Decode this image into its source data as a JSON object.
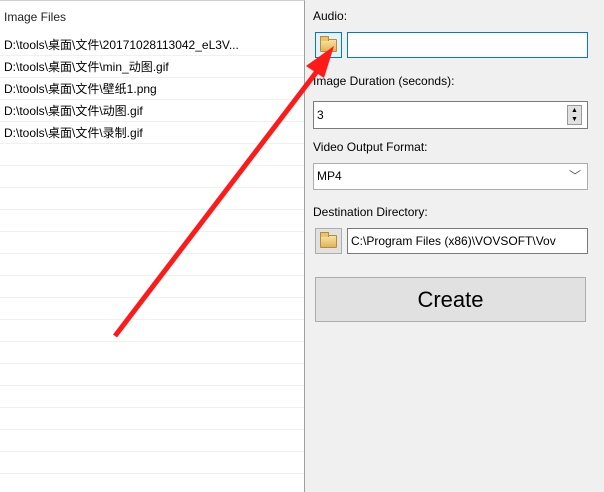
{
  "list": {
    "header": "Image Files",
    "items": [
      "D:\\tools\\桌面\\文件\\20171028113042_eL3V...",
      "D:\\tools\\桌面\\文件\\min_动图.gif",
      "D:\\tools\\桌面\\文件\\壁纸1.png",
      "D:\\tools\\桌面\\文件\\动图.gif",
      "D:\\tools\\桌面\\文件\\录制.gif"
    ]
  },
  "audio": {
    "label": "Audio:",
    "value": ""
  },
  "duration": {
    "label": "Image Duration (seconds):",
    "value": "3"
  },
  "format": {
    "label": "Video Output Format:",
    "value": "MP4"
  },
  "destination": {
    "label": "Destination Directory:",
    "value": "C:\\Program Files (x86)\\VOVSOFT\\Vov"
  },
  "create_label": "Create",
  "annotation_color": "#ff1a1a"
}
